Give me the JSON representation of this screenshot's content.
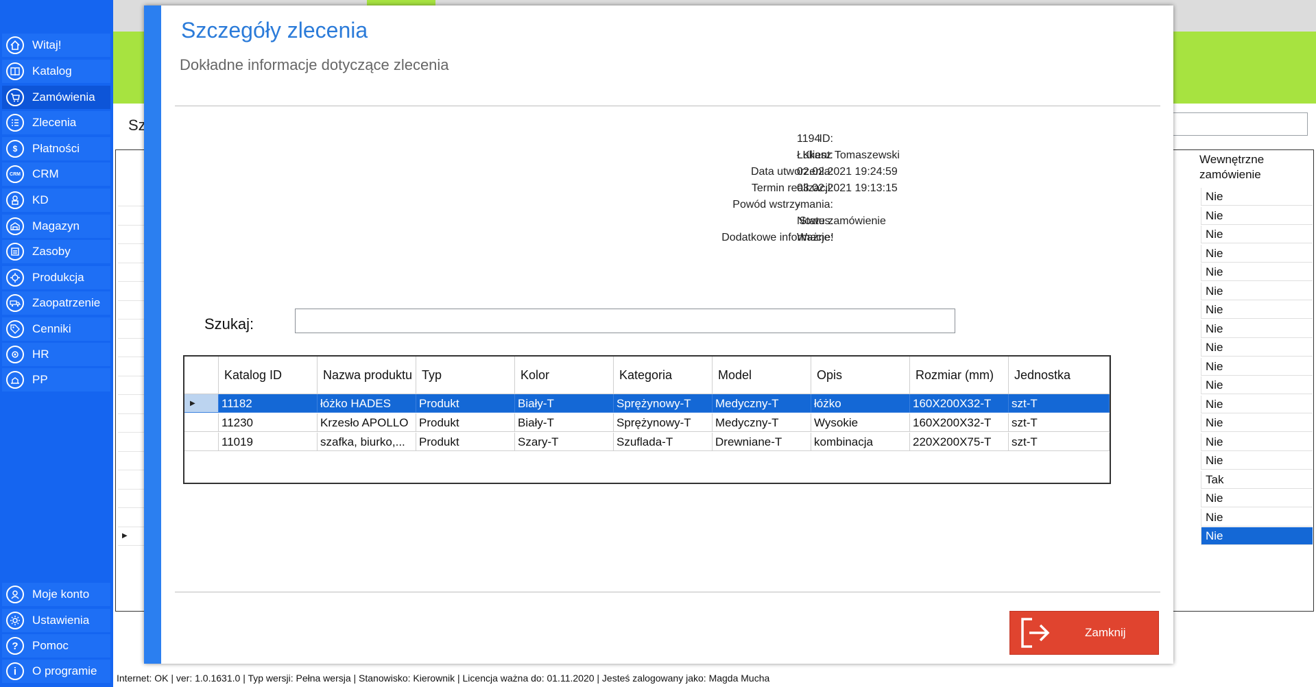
{
  "sidebar": {
    "items": [
      {
        "label": "Witaj!",
        "icon": "home-icon"
      },
      {
        "label": "Katalog",
        "icon": "book-icon"
      },
      {
        "label": "Zamówienia",
        "icon": "cart-icon"
      },
      {
        "label": "Zlecenia",
        "icon": "list-icon"
      },
      {
        "label": "Płatności",
        "icon": "dollar-icon"
      },
      {
        "label": "CRM",
        "icon": "crm-icon"
      },
      {
        "label": "KD",
        "icon": "user-lock-icon"
      },
      {
        "label": "Magazyn",
        "icon": "warehouse-icon"
      },
      {
        "label": "Zasoby",
        "icon": "resources-icon"
      },
      {
        "label": "Produkcja",
        "icon": "production-icon"
      },
      {
        "label": "Zaopatrzenie",
        "icon": "supply-icon"
      },
      {
        "label": "Cenniki",
        "icon": "tag-icon"
      },
      {
        "label": "HR",
        "icon": "hr-icon"
      },
      {
        "label": "PP",
        "icon": "pp-icon"
      }
    ],
    "bottom_items": [
      {
        "label": "Moje konto",
        "icon": "account-icon"
      },
      {
        "label": "Ustawienia",
        "icon": "gear-icon"
      },
      {
        "label": "Pomoc",
        "icon": "help-icon"
      },
      {
        "label": "O programie",
        "icon": "info-icon"
      }
    ]
  },
  "background": {
    "search_label": "Sz",
    "column_header": "Wewnętrzne zamówienie",
    "column_values": [
      "Nie",
      "Nie",
      "Nie",
      "Nie",
      "Nie",
      "Nie",
      "Nie",
      "Nie",
      "Nie",
      "Nie",
      "Nie",
      "Nie",
      "Nie",
      "Nie",
      "Nie",
      "Tak",
      "Nie",
      "Nie",
      "Nie"
    ]
  },
  "modal": {
    "title": "Szczegóły zlecenia",
    "subtitle": "Dokładne informacje dotyczące zlecenia",
    "info": [
      {
        "label": "ID:",
        "value": "1194"
      },
      {
        "label": "Klient:",
        "value": "Łukasz Tomaszewski"
      },
      {
        "label": "Data utworzenia:",
        "value": "02.02.2021 19:24:59"
      },
      {
        "label": "Termin realizacji:",
        "value": "03.02.2021 19:13:15"
      },
      {
        "label": "Powód wstrzymania:",
        "value": "-"
      },
      {
        "label": "Status:",
        "value": "Nowe zamówienie"
      },
      {
        "label": "Dodatkowe informacje:",
        "value": "Ważne!"
      }
    ],
    "search_label": "Szukaj:",
    "search_value": "",
    "grid": {
      "columns": [
        "Katalog ID",
        "Nazwa produktu",
        "Typ",
        "Kolor",
        "Kategoria",
        "Model",
        "Opis",
        "Rozmiar (mm)",
        "Jednostka"
      ],
      "rows": [
        [
          "11182",
          "łóżko HADES",
          "Produkt",
          "Biały-T",
          "Sprężynowy-T",
          "Medyczny-T",
          "łóżko",
          "160X200X32-T",
          "szt-T"
        ],
        [
          "11230",
          "Krzesło APOLLO",
          "Produkt",
          "Biały-T",
          "Sprężynowy-T",
          "Medyczny-T",
          "Wysokie",
          "160X200X32-T",
          "szt-T"
        ],
        [
          "11019",
          "szafka, biurko,...",
          "Produkt",
          "Szary-T",
          "Szuflada-T",
          "Drewniane-T",
          "kombinacja",
          "220X200X75-T",
          "szt-T"
        ]
      ],
      "selected_row": 0
    },
    "close_label": "Zamknij"
  },
  "statusbar": {
    "text": "Internet: OK  |   ver: 1.0.1631.0   |   Typ wersji: Pełna wersja   |   Stanowisko: Kierownik   |   Licencja ważna do: 01.11.2020   |   Jesteś zalogowany jako: Magda Mucha"
  },
  "colors": {
    "sidebar": "#1565f0",
    "accent_green": "#a7e340",
    "title_blue": "#2b7bd9",
    "selection": "#1468d6",
    "close_red": "#e0442f"
  }
}
